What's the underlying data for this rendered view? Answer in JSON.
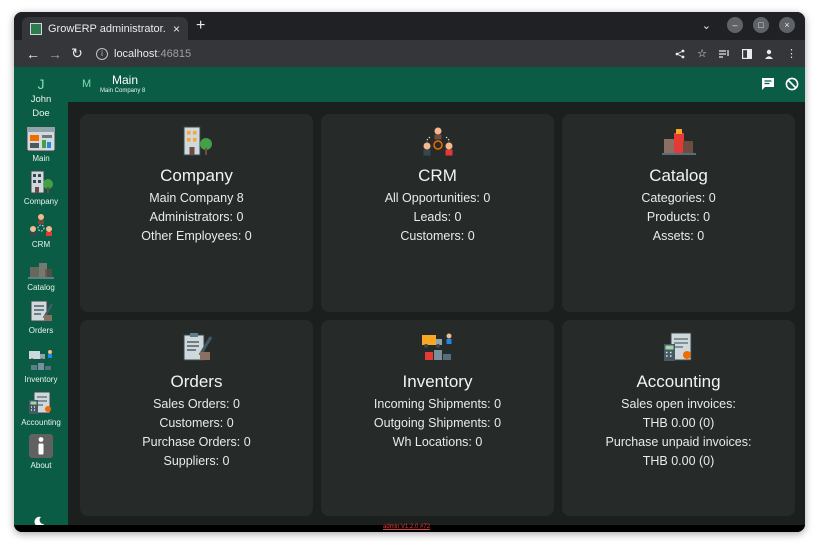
{
  "browser": {
    "tab_title": "GrowERP administrator.",
    "tab_close": "×",
    "new_tab": "+",
    "url_host": "localhost",
    "url_port": ":46815"
  },
  "sidebar": {
    "user_initial": "J",
    "user_first": "John",
    "user_last": "Doe",
    "items": [
      {
        "label": "Main"
      },
      {
        "label": "Company"
      },
      {
        "label": "CRM"
      },
      {
        "label": "Catalog"
      },
      {
        "label": "Orders"
      },
      {
        "label": "Inventory"
      },
      {
        "label": "Accounting"
      },
      {
        "label": "About"
      }
    ]
  },
  "appbar": {
    "icon_letter": "M",
    "title": "Main",
    "subtitle": "Main Company 8"
  },
  "cards": {
    "company": {
      "title": "Company",
      "lines": [
        "Main Company 8",
        "Administrators: 0",
        "Other Employees: 0"
      ]
    },
    "crm": {
      "title": "CRM",
      "lines": [
        "All Opportunities: 0",
        "Leads: 0",
        "Customers: 0"
      ]
    },
    "catalog": {
      "title": "Catalog",
      "lines": [
        "Categories: 0",
        "Products: 0",
        "Assets: 0"
      ]
    },
    "orders": {
      "title": "Orders",
      "lines": [
        "Sales Orders: 0",
        "Customers: 0",
        "Purchase Orders: 0",
        "Suppliers: 0"
      ]
    },
    "inventory": {
      "title": "Inventory",
      "lines": [
        "Incoming Shipments: 0",
        "Outgoing Shipments: 0",
        "Wh Locations: 0"
      ]
    },
    "accounting": {
      "title": "Accounting",
      "lines": [
        "Sales open invoices:",
        "THB 0.00 (0)",
        "Purchase unpaid invoices:",
        "THB 0.00 (0)"
      ]
    }
  },
  "status": {
    "version": "admin V1.2.0 #72"
  },
  "colors": {
    "brand": "#0a5c44",
    "card": "#262b29",
    "background": "#1b1f1d"
  }
}
